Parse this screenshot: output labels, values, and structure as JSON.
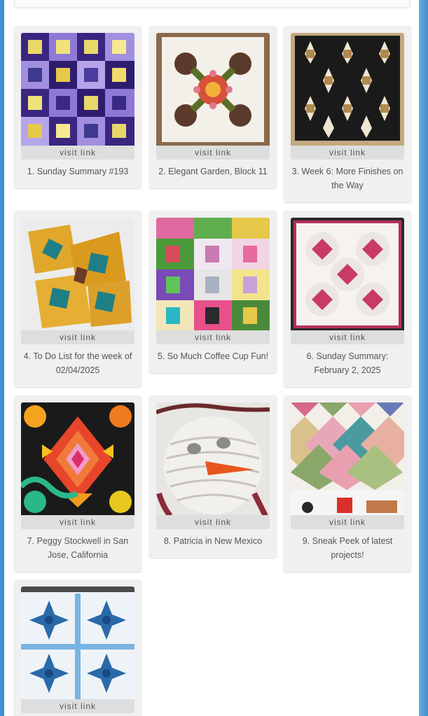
{
  "visit_label": "visit link",
  "cards": [
    {
      "caption": "1. Sunday Summary #193",
      "thumb": "log-cabin-quilt-purple-yellow"
    },
    {
      "caption": "2. Elegant Garden, Block 11",
      "thumb": "applique-flower-block"
    },
    {
      "caption": "3. Week 6: More Finishes on the Way",
      "thumb": "star-quilt-black-cream"
    },
    {
      "caption": "4. To Do List for the week of 02/04/2025",
      "thumb": "gold-teal-quilt-blocks"
    },
    {
      "caption": "5. So Much Coffee Cup Fun!",
      "thumb": "coffee-cup-quilt"
    },
    {
      "caption": "6. Sunday Summary: February 2, 2025",
      "thumb": "pink-white-curved-quilt"
    },
    {
      "caption": "7. Peggy Stockwell in San Jose, California",
      "thumb": "orange-black-swirl-quilt"
    },
    {
      "caption": "8. Patricia in New Mexico",
      "thumb": "yarn-snowman-face"
    },
    {
      "caption": "9. Sneak Peek of latest projects!",
      "thumb": "pastel-diamond-quilt"
    },
    {
      "caption": "",
      "thumb": "blue-star-quilt"
    }
  ]
}
